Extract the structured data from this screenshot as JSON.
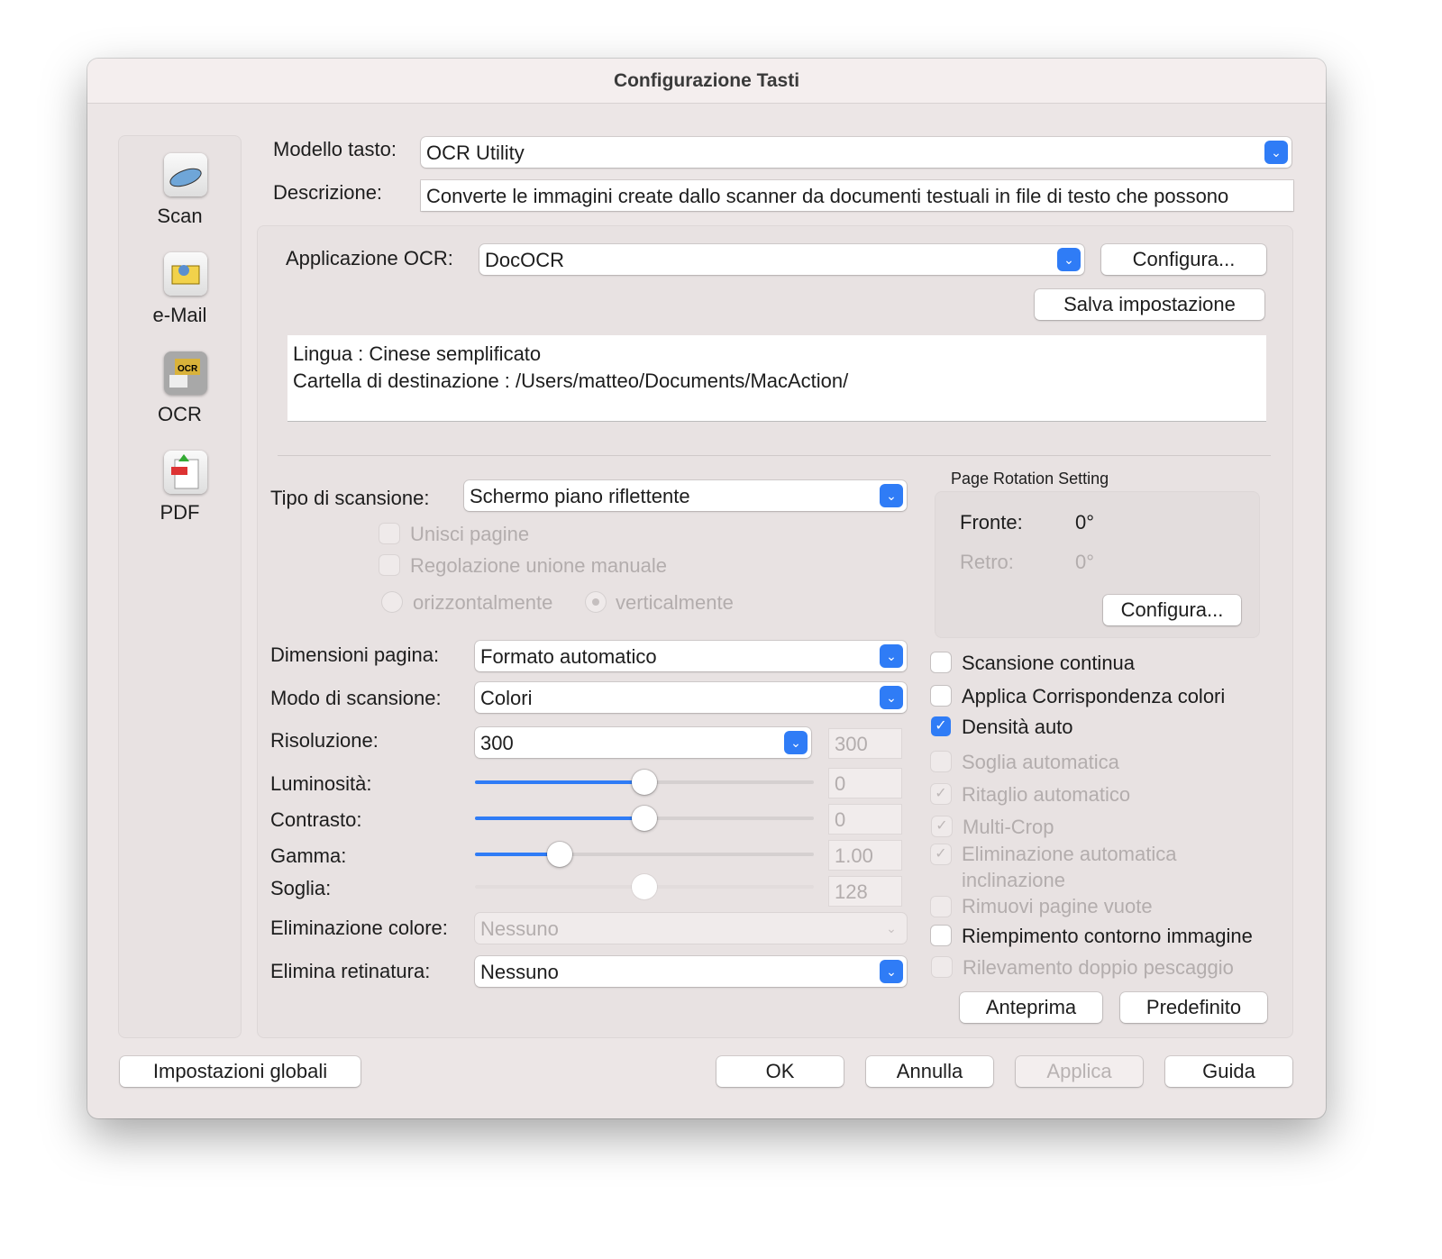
{
  "window": {
    "title": "Configurazione Tasti"
  },
  "sidebar": {
    "items": [
      {
        "label": "Scan",
        "icon": "scanner-icon"
      },
      {
        "label": "e-Mail",
        "icon": "email-icon"
      },
      {
        "label": "OCR",
        "icon": "ocr-icon"
      },
      {
        "label": "PDF",
        "icon": "pdf-icon"
      }
    ]
  },
  "header": {
    "model_label": "Modello tasto:",
    "model_value": "OCR Utility",
    "desc_label": "Descrizione:",
    "desc_value": "Converte le immagini create dallo scanner da documenti testuali in file di testo che possono"
  },
  "ocr": {
    "app_label": "Applicazione OCR:",
    "app_value": "DocOCR",
    "configure": "Configura...",
    "save": "Salva impostazione",
    "info_line1": "Lingua : Cinese semplificato",
    "info_line2": "Cartella di destinazione : /Users/matteo/Documents/MacAction/"
  },
  "scan": {
    "type_label": "Tipo di scansione:",
    "type_value": "Schermo piano riflettente",
    "merge": "Unisci pagine",
    "manual_merge": "Regolazione unione manuale",
    "horizontal": "orizzontalmente",
    "vertical": "verticalmente",
    "page_size_label": "Dimensioni pagina:",
    "page_size_value": "Formato automatico",
    "mode_label": "Modo di scansione:",
    "mode_value": "Colori",
    "resolution_label": "Risoluzione:",
    "resolution_value": "300",
    "resolution_field": "300",
    "brightness_label": "Luminosità:",
    "brightness_value": "0",
    "brightness_fraction": 0.5,
    "contrast_label": "Contrasto:",
    "contrast_value": "0",
    "contrast_fraction": 0.5,
    "gamma_label": "Gamma:",
    "gamma_value": "1.00",
    "gamma_fraction": 0.25,
    "threshold_label": "Soglia:",
    "threshold_value": "128",
    "threshold_fraction": 0.5,
    "dropout_label": "Eliminazione colore:",
    "dropout_value": "Nessuno",
    "descreen_label": "Elimina retinatura:",
    "descreen_value": "Nessuno"
  },
  "rotation": {
    "title": "Page Rotation Setting",
    "front_label": "Fronte:",
    "front_value": "0°",
    "back_label": "Retro:",
    "back_value": "0°",
    "configure": "Configura..."
  },
  "options": [
    {
      "label": "Scansione continua",
      "checked": false,
      "enabled": true
    },
    {
      "label": "Applica Corrispondenza colori",
      "checked": false,
      "enabled": true
    },
    {
      "label": "Densità auto",
      "checked": true,
      "enabled": true
    },
    {
      "label": "Soglia automatica",
      "checked": false,
      "enabled": false
    },
    {
      "label": "Ritaglio automatico",
      "checked": true,
      "enabled": false
    },
    {
      "label": "Multi-Crop",
      "checked": true,
      "enabled": false
    },
    {
      "label": "Eliminazione automatica",
      "label2": "inclinazione",
      "checked": true,
      "enabled": false
    },
    {
      "label": "Rimuovi pagine vuote",
      "checked": false,
      "enabled": false
    },
    {
      "label": "Riempimento contorno immagine",
      "checked": false,
      "enabled": true
    },
    {
      "label": "Rilevamento doppio pescaggio",
      "checked": false,
      "enabled": false
    }
  ],
  "actions": {
    "preview": "Anteprima",
    "default": "Predefinito"
  },
  "footer": {
    "global": "Impostazioni globali",
    "ok": "OK",
    "cancel": "Annulla",
    "apply": "Applica",
    "help": "Guida"
  },
  "colors": {
    "accent": "#2f7cf6"
  }
}
